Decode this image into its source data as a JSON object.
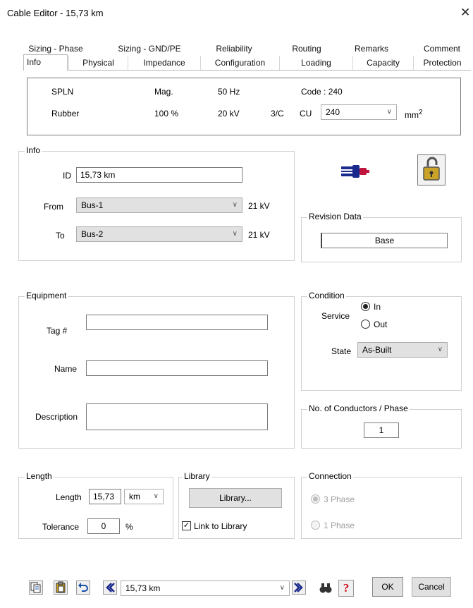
{
  "window": {
    "title": "Cable Editor - 15,73 km",
    "close_glyph": "✕"
  },
  "tabs": {
    "row1": [
      "Sizing - Phase",
      "Sizing - GND/PE",
      "Reliability",
      "Routing",
      "Remarks",
      "Comment"
    ],
    "row2": [
      "Info",
      "Physical",
      "Impedance",
      "Configuration",
      "Loading",
      "Capacity",
      "Protection"
    ],
    "active": "Info"
  },
  "header": {
    "standard": "SPLN",
    "magnetic": "Mag.",
    "frequency": "50 Hz",
    "code": "Code : 240",
    "insulation": "Rubber",
    "percent": "100 %",
    "voltage": "20 kV",
    "cores": "3/C",
    "conductor": "CU",
    "size": "240",
    "unit": "mm",
    "unit_sup": "2"
  },
  "info": {
    "group_label": "Info",
    "id_label": "ID",
    "id_value": "15,73 km",
    "from_label": "From",
    "from_value": "Bus-1",
    "from_kv": "21 kV",
    "to_label": "To",
    "to_value": "Bus-2",
    "to_kv": "21 kV"
  },
  "icons": {
    "cable": "cable-plug-icon",
    "lock": "padlock-icon"
  },
  "revision": {
    "group_label": "Revision Data",
    "value": "Base"
  },
  "equipment": {
    "group_label": "Equipment",
    "tag_label": "Tag #",
    "tag_value": "",
    "name_label": "Name",
    "name_value": "",
    "desc_label": "Description",
    "desc_value": ""
  },
  "condition": {
    "group_label": "Condition",
    "service_label": "Service",
    "in_label": "In",
    "out_label": "Out",
    "service_selected": "In",
    "state_label": "State",
    "state_value": "As-Built"
  },
  "conductors": {
    "group_label": "No. of Conductors / Phase",
    "value": "1"
  },
  "length": {
    "group_label": "Length",
    "length_label": "Length",
    "length_value": "15,73",
    "unit": "km",
    "tolerance_label": "Tolerance",
    "tolerance_value": "0",
    "tolerance_unit": "%"
  },
  "library": {
    "group_label": "Library",
    "button": "Library...",
    "link_label": "Link to Library",
    "link_checked": true
  },
  "connection": {
    "group_label": "Connection",
    "three_phase": "3 Phase",
    "one_phase": "1 Phase",
    "selected": "3 Phase"
  },
  "footer": {
    "nav_value": "15,73 km",
    "ok": "OK",
    "cancel": "Cancel"
  }
}
